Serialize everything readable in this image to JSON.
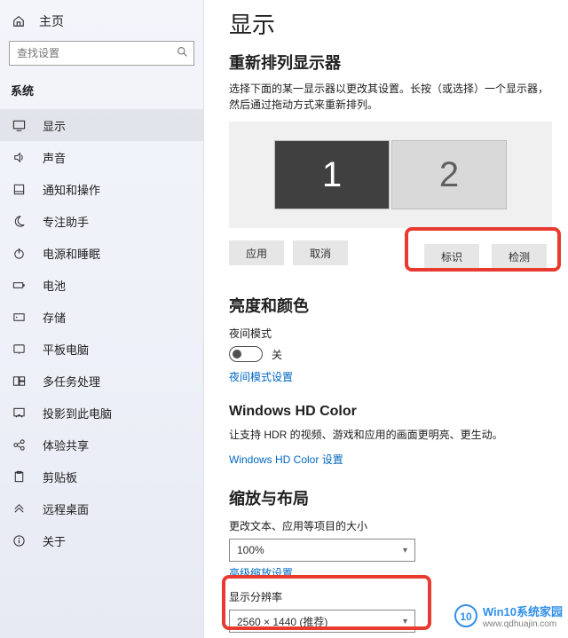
{
  "sidebar": {
    "home": "主页",
    "search_placeholder": "查找设置",
    "category": "系统",
    "items": [
      {
        "icon": "monitor-icon",
        "label": "显示",
        "active": true
      },
      {
        "icon": "speaker-icon",
        "label": "声音",
        "active": false
      },
      {
        "icon": "bell-icon",
        "label": "通知和操作",
        "active": false
      },
      {
        "icon": "moon-icon",
        "label": "专注助手",
        "active": false
      },
      {
        "icon": "power-icon",
        "label": "电源和睡眠",
        "active": false
      },
      {
        "icon": "battery-icon",
        "label": "电池",
        "active": false
      },
      {
        "icon": "storage-icon",
        "label": "存储",
        "active": false
      },
      {
        "icon": "tablet-icon",
        "label": "平板电脑",
        "active": false
      },
      {
        "icon": "multitask-icon",
        "label": "多任务处理",
        "active": false
      },
      {
        "icon": "cast-icon",
        "label": "投影到此电脑",
        "active": false
      },
      {
        "icon": "share-icon",
        "label": "体验共享",
        "active": false
      },
      {
        "icon": "clipboard-icon",
        "label": "剪贴板",
        "active": false
      },
      {
        "icon": "remote-icon",
        "label": "远程桌面",
        "active": false
      },
      {
        "icon": "info-icon",
        "label": "关于",
        "active": false
      }
    ]
  },
  "main": {
    "title": "显示",
    "rearrange": {
      "heading": "重新排列显示器",
      "desc": "选择下面的某一显示器以更改其设置。长按（或选择）一个显示器，然后通过拖动方式来重新排列。",
      "mon1": "1",
      "mon2": "2",
      "apply": "应用",
      "cancel": "取消",
      "identify": "标识",
      "detect": "检测"
    },
    "brightness": {
      "heading": "亮度和颜色",
      "night_label": "夜间模式",
      "night_state": "关",
      "night_settings": "夜间模式设置"
    },
    "hdcolor": {
      "heading": "Windows HD Color",
      "desc": "让支持 HDR 的视频、游戏和应用的画面更明亮、更生动。",
      "link": "Windows HD Color 设置"
    },
    "scale": {
      "heading": "缩放与布局",
      "size_label": "更改文本、应用等项目的大小",
      "size_value": "100%",
      "adv_link": "高级缩放设置",
      "res_label": "显示分辨率",
      "res_value": "2560 × 1440 (推荐)"
    }
  },
  "watermark": {
    "brand": "Win10系统家园",
    "url": "www.qdhuajin.com"
  }
}
